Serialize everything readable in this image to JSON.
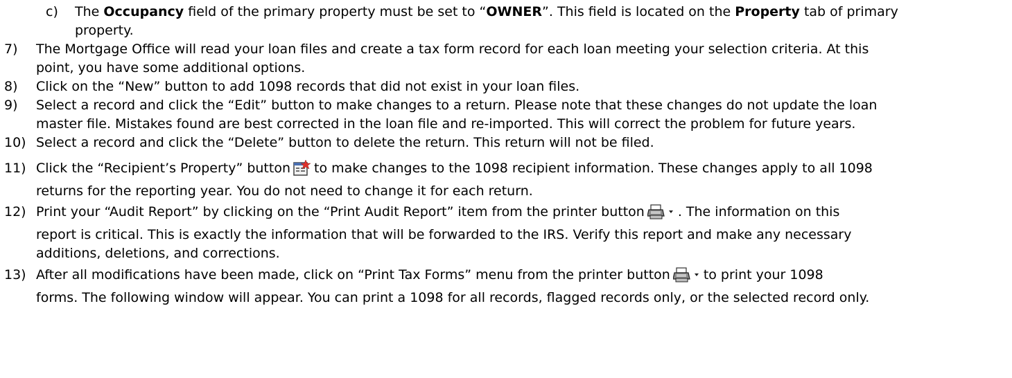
{
  "items": [
    {
      "num": "c)",
      "line1_parts": [
        "The ",
        "Occupancy",
        " field of the primary property must be set to “",
        "OWNER",
        "”. This field is located on the ",
        "Property",
        " tab of primary"
      ],
      "line2": "property."
    },
    {
      "num": "7)",
      "line1": "The Mortgage Office will read your loan files and create a tax form record for each loan meeting your selection criteria. At this",
      "line2": "point, you have some additional options."
    },
    {
      "num": "8)",
      "line1": "Click on the “New” button to add 1098 records that did not exist in your loan files."
    },
    {
      "num": "9)",
      "line1": "Select a record and click the “Edit” button to make changes to a return. Please note that these changes do not update the loan",
      "line2": "master file. Mistakes found are best corrected in the loan file and re-imported. This will correct the problem for future years."
    },
    {
      "num": "10)",
      "line1": "Select a record and click the “Delete” button to delete the return. This return will not be filed."
    },
    {
      "num": "11)",
      "line1_a": "Click the “Recipient’s Property” button",
      "line1_b": "to make changes to the 1098 recipient information. These changes apply to all 1098",
      "line2": "returns for the reporting year. You do not need to change it for each return."
    },
    {
      "num": "12)",
      "line1_a": "Print your “Audit Report” by clicking on the “Print Audit Report” item from the printer button",
      "line1_b": ". The information on this",
      "line2": "report is critical. This is exactly the information that will be forwarded to the IRS. Verify this report and make any necessary",
      "line3": "additions, deletions, and corrections."
    },
    {
      "num": "13)",
      "line1_a": "After all modifications have been made, click on “Print Tax Forms” menu from the printer button",
      "line1_b": "to print your 1098",
      "line2": "forms. The following window will appear. You can print a 1098 for all records, flagged records only, or the selected record only."
    }
  ],
  "icons": {
    "properties": "properties-icon",
    "printer": "printer-dropdown-icon"
  },
  "colors": {
    "text": "#000000",
    "background": "#ffffff"
  }
}
